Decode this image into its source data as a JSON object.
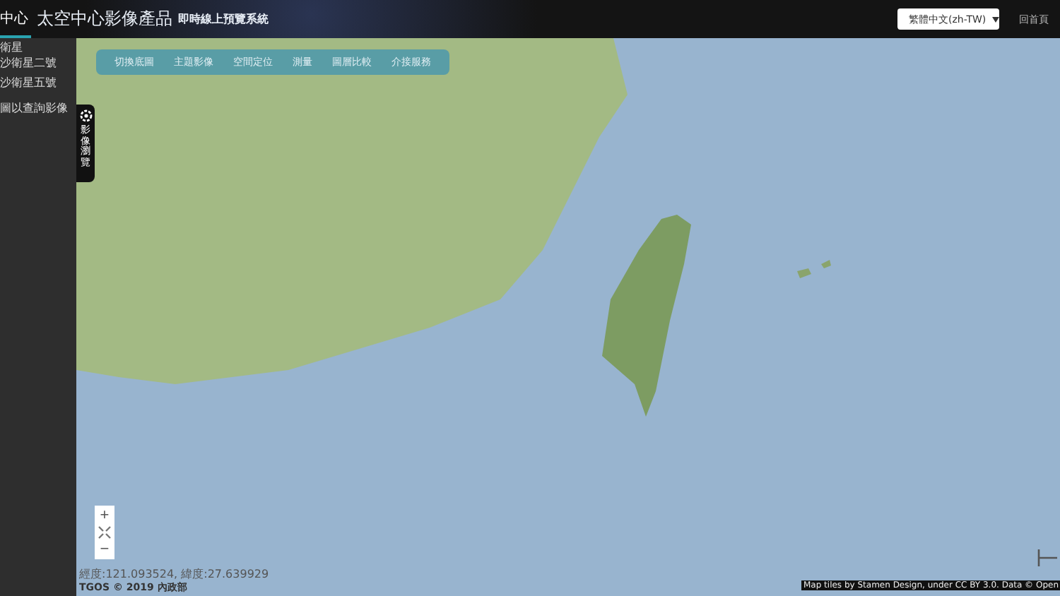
{
  "header": {
    "logo_text": "中心",
    "title": "太空中心影像產品",
    "subtitle": "即時線上預覽系統",
    "language": "繁體中文(zh-TW)",
    "home_link": "回首頁"
  },
  "sidebar": {
    "items": [
      {
        "label": "衛星"
      },
      {
        "label": "沙衛星二號"
      },
      {
        "label": "沙衛星五號"
      },
      {
        "label": "圖以查詢影像"
      }
    ]
  },
  "toolbar": {
    "items": [
      {
        "label": "切換底圖"
      },
      {
        "label": "主題影像"
      },
      {
        "label": "空間定位"
      },
      {
        "label": "測量"
      },
      {
        "label": "圖層比較"
      },
      {
        "label": "介接服務"
      }
    ]
  },
  "side_tab": {
    "label": "影像瀏覽"
  },
  "map": {
    "zoom_in": "+",
    "zoom_out": "−",
    "coordinates": "經度:121.093524, 緯度:27.639929",
    "copyright": "TGOS © 2019 內政部",
    "attribution": "Map tiles by Stamen Design, under CC BY 3.0. Data © Open"
  }
}
